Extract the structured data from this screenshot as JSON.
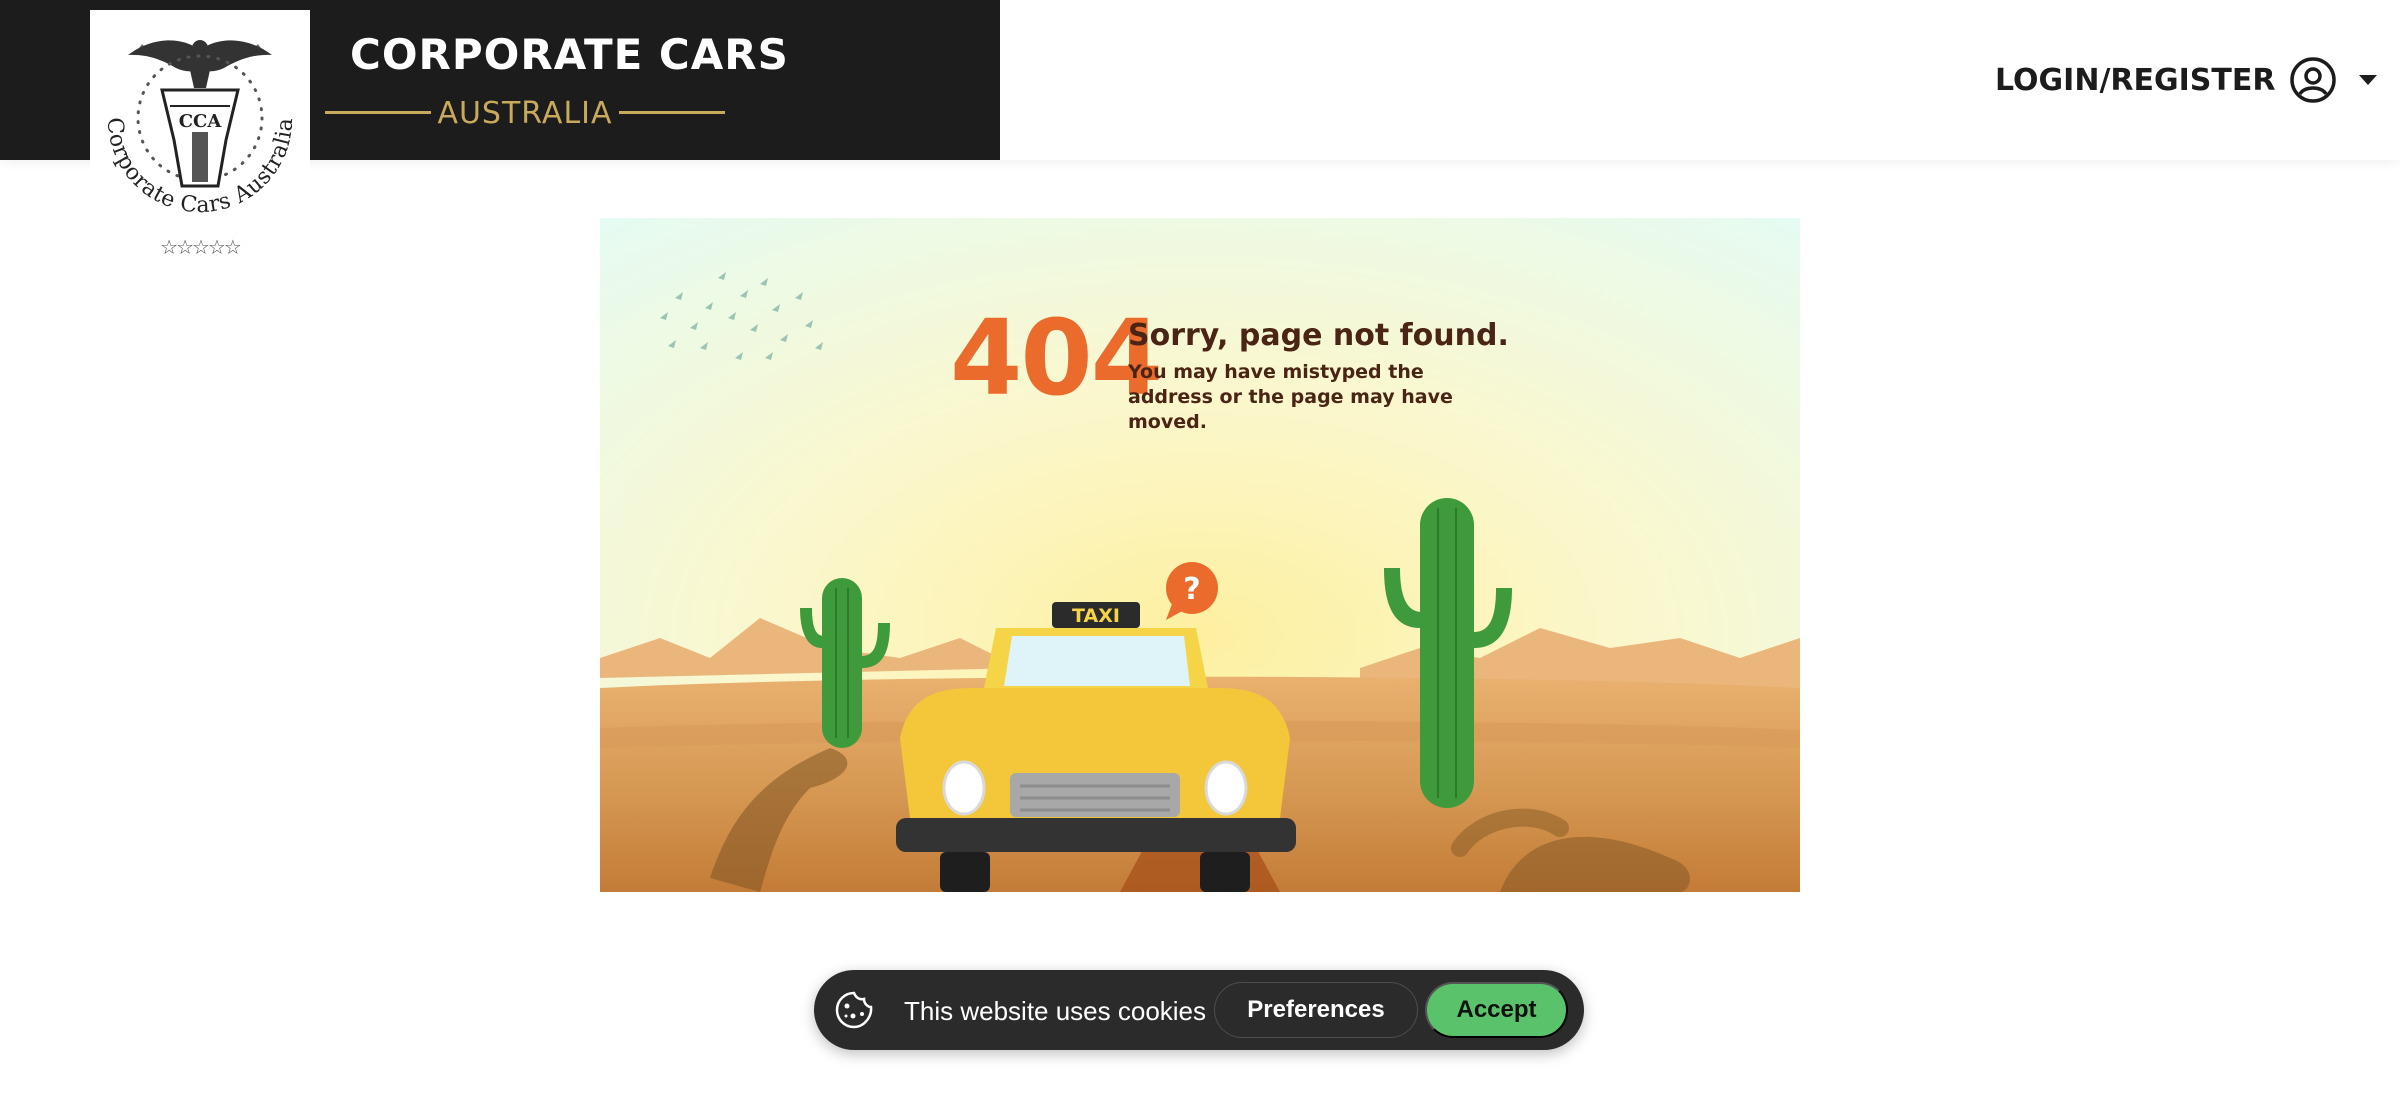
{
  "header": {
    "brand_title": "CORPORATE CARS",
    "brand_subtitle": "AUSTRALIA",
    "logo": {
      "initials": "CCA",
      "ring_text": "Corporate Cars Australia",
      "rating_stars": "☆☆☆☆☆"
    },
    "login_label": "LOGIN/REGISTER",
    "login_icon": "user-circle-icon",
    "dropdown_icon": "caret-down-icon"
  },
  "error_page": {
    "code": "404",
    "title": "Sorry, page not found.",
    "message": "You may have mistyped the address or the page may have moved.",
    "taxi_sign": "TAXI",
    "bubble_symbol": "?"
  },
  "cookie_banner": {
    "icon": "cookie-icon",
    "text": "This website uses cookies",
    "preferences_label": "Preferences",
    "accept_label": "Accept"
  },
  "colors": {
    "brand_dark": "#1c1c1c",
    "brand_gold": "#c9a95c",
    "error_orange": "#ea6b2c",
    "accept_green": "#5ac26a",
    "taxi_yellow": "#f6d447"
  }
}
